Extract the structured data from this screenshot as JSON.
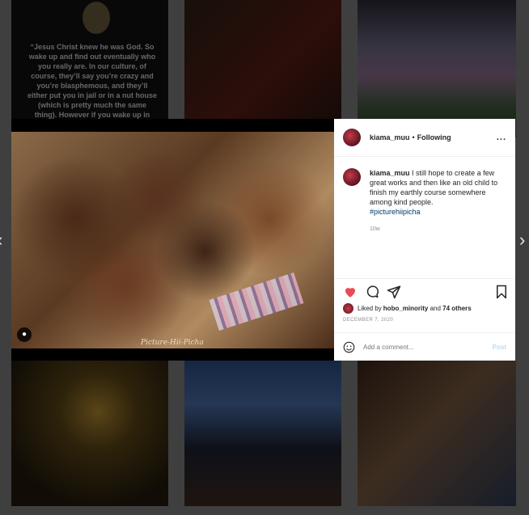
{
  "background": {
    "quote_text": "“Jesus Christ knew he was God. So wake up and find out eventually who you really are. In our culture, of course, they’ll say you’re crazy and you’re blasphemous, and they’ll either put you in jail or in a nut house (which is pretty much the same thing). However if you wake up in India and tell your friends and relations, ‘My goodness, I’ve just discovered that I’m"
  },
  "nav": {
    "prev_icon": "chevron-left",
    "next_icon": "chevron-right",
    "prev_glyph": "‹",
    "next_glyph": "›"
  },
  "post": {
    "watermark": "Picture-Hii-Picha",
    "header": {
      "username": "kiama_muu",
      "separator": "•",
      "follow_status": "Following",
      "more": "..."
    },
    "caption": {
      "username": "kiama_muu",
      "text": " I still hope to create a few great works and then like an old child to finish my earthly course somewhere among kind people.",
      "hashtag": "#picturehiipicha",
      "age": "10w"
    },
    "likes": {
      "prefix": "Liked by ",
      "user": "hobo_minority",
      "middle": " and ",
      "others": "74 others"
    },
    "date": "DECEMBER 7, 2020",
    "comment": {
      "placeholder": "Add a comment...",
      "post_label": "Post"
    },
    "colors": {
      "like": "#ed4956",
      "link": "#00376b",
      "post_disabled": "#b2dffc"
    }
  }
}
